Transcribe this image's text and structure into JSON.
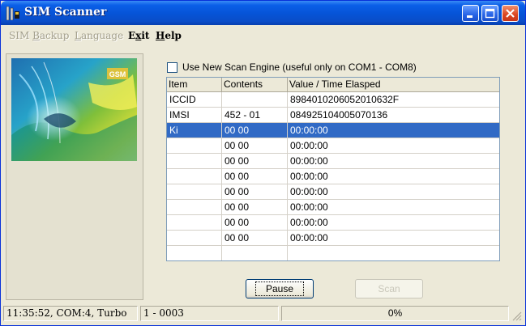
{
  "window": {
    "title": "SIM Scanner",
    "controls": {
      "minimize": "minimize",
      "maximize": "maximize",
      "close": "close"
    }
  },
  "menu": {
    "sim_backup": {
      "pre": "SIM ",
      "u": "B",
      "post": "ackup"
    },
    "language": {
      "pre": "",
      "u": "L",
      "post": "anguage"
    },
    "exit": {
      "pre": "E",
      "u": "x",
      "post": "it"
    },
    "help": {
      "pre": "",
      "u": "H",
      "post": "elp"
    }
  },
  "picture": {
    "badge": "GSM"
  },
  "scan_engine": {
    "checked": false,
    "label": "Use New Scan Engine (useful only on COM1 - COM8)"
  },
  "table": {
    "headers": [
      "Item",
      "Contents",
      "Value / Time Elasped"
    ],
    "rows": [
      {
        "item": "ICCID",
        "contents": "",
        "value": "8984010206052010632F"
      },
      {
        "item": "IMSI",
        "contents": "452 - 01",
        "value": "084925104005070136"
      },
      {
        "item": "Ki",
        "contents": "00 00",
        "value": "00:00:00",
        "selected": true
      },
      {
        "item": "",
        "contents": "00 00",
        "value": "00:00:00"
      },
      {
        "item": "",
        "contents": "00 00",
        "value": "00:00:00"
      },
      {
        "item": "",
        "contents": "00 00",
        "value": "00:00:00"
      },
      {
        "item": "",
        "contents": "00 00",
        "value": "00:00:00"
      },
      {
        "item": "",
        "contents": "00 00",
        "value": "00:00:00"
      },
      {
        "item": "",
        "contents": "00 00",
        "value": "00:00:00"
      },
      {
        "item": "",
        "contents": "00 00",
        "value": "00:00:00"
      },
      {
        "item": "",
        "contents": "",
        "value": ""
      }
    ]
  },
  "buttons": {
    "pause": "Pause",
    "scan": "Scan"
  },
  "status": {
    "time_port": "11:35:52, COM:4, Turbo",
    "counter": "1 - 0003",
    "progress": "0%"
  },
  "colors": {
    "title_bar": "#0653d6",
    "selection": "#316ac5",
    "close_button": "#db4520"
  }
}
